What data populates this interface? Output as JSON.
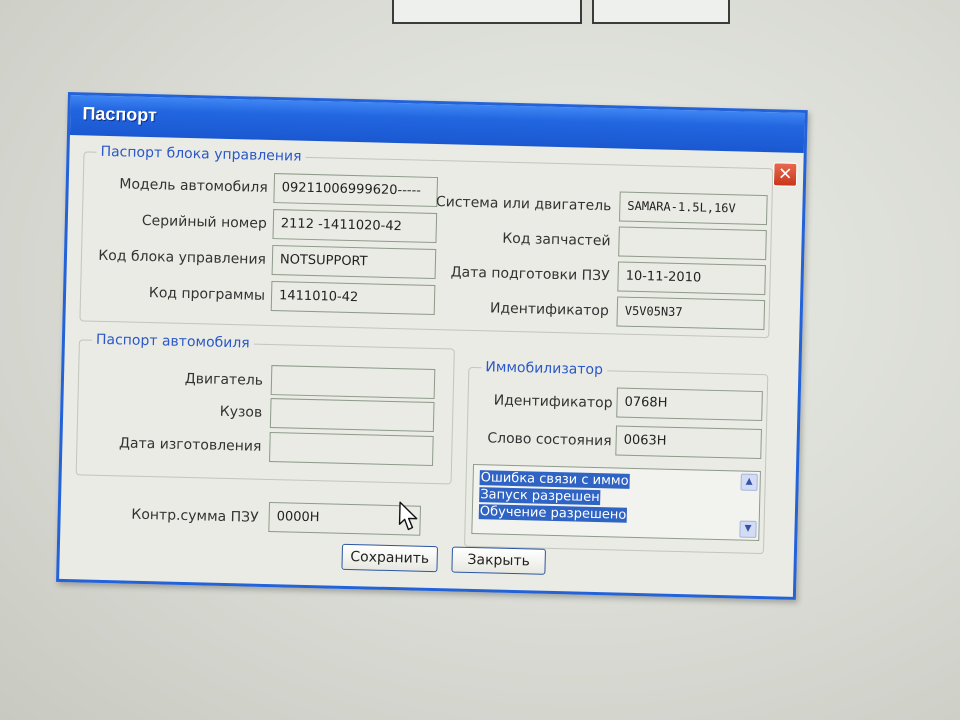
{
  "window": {
    "title": "Паспорт",
    "close_icon": "✕"
  },
  "ecu_passport": {
    "legend": "Паспорт блока управления",
    "model_label": "Модель автомобиля",
    "model_value": "09211006999620-----",
    "serial_label": "Серийный номер",
    "serial_value": "2112 -1411020-42",
    "ecu_code_label": "Код блока управления",
    "ecu_code_value": "NOTSUPPORT",
    "program_code_label": "Код программы",
    "program_code_value": "1411010-42",
    "system_label": "Система или двигатель",
    "system_value": "SAMARA-1.5L,16V",
    "parts_code_label": "Код запчастей",
    "parts_code_value": "",
    "rom_date_label": "Дата подготовки ПЗУ",
    "rom_date_value": "10-11-2010",
    "identifier_label": "Идентификатор",
    "identifier_value": "V5V05N37"
  },
  "car_passport": {
    "legend": "Паспорт автомобиля",
    "engine_label": "Двигатель",
    "engine_value": "",
    "body_label": "Кузов",
    "body_value": "",
    "manufacture_date_label": "Дата изготовления",
    "manufacture_date_value": ""
  },
  "immobilizer": {
    "legend": "Иммобилизатор",
    "identifier_label": "Идентификатор",
    "identifier_value": "0768H",
    "status_word_label": "Слово состояния",
    "status_word_value": "0063H",
    "messages": [
      "Ошибка связи с иммо",
      "Запуск разрешен",
      "Обучение разрешено"
    ]
  },
  "rom_checksum": {
    "label": "Контр.сумма ПЗУ",
    "value": "0000H"
  },
  "buttons": {
    "save_label": "Сохранить",
    "close_label": "Закрыть"
  },
  "colors": {
    "titlebar": "#2266e0",
    "legend_text": "#2b58c8",
    "selection": "#2f64c4",
    "close_button": "#d24a2e"
  }
}
